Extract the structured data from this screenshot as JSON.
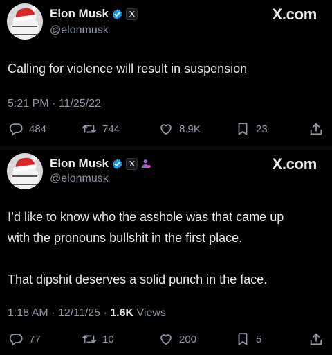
{
  "tweets": [
    {
      "name": "Elon Musk",
      "handle": "@elonmusk",
      "brand": "X.com",
      "text_lines": [
        "Calling for violence will result in suspension"
      ],
      "time": "5:21 PM",
      "date": "11/25/22",
      "replies": "484",
      "retweets": "744",
      "likes": "8.9K",
      "bookmarks": "23"
    },
    {
      "name": "Elon Musk",
      "handle": "@elonmusk",
      "brand": "X.com",
      "text_lines": [
        "I’d like to know who the asshole was that came up",
        "with the pronouns bullshit in the first place.",
        "",
        "That dipshit deserves a solid punch in the face."
      ],
      "time": "1:18 AM",
      "date": "12/11/25",
      "views_count": "1.6K",
      "views_label": "Views",
      "replies": "77",
      "retweets": "10",
      "likes": "200",
      "bookmarks": "5"
    }
  ],
  "colors": {
    "background": "#000000",
    "text": "#e7e9ea",
    "muted": "#8b98a5",
    "verified": "#1d9bf0",
    "accent_purple": "#a259d9"
  },
  "icons": [
    "avatar",
    "verified-badge-icon",
    "x-logo-icon",
    "person-badge-icon",
    "reply-icon",
    "retweet-icon",
    "like-icon",
    "bookmark-icon",
    "share-icon"
  ]
}
